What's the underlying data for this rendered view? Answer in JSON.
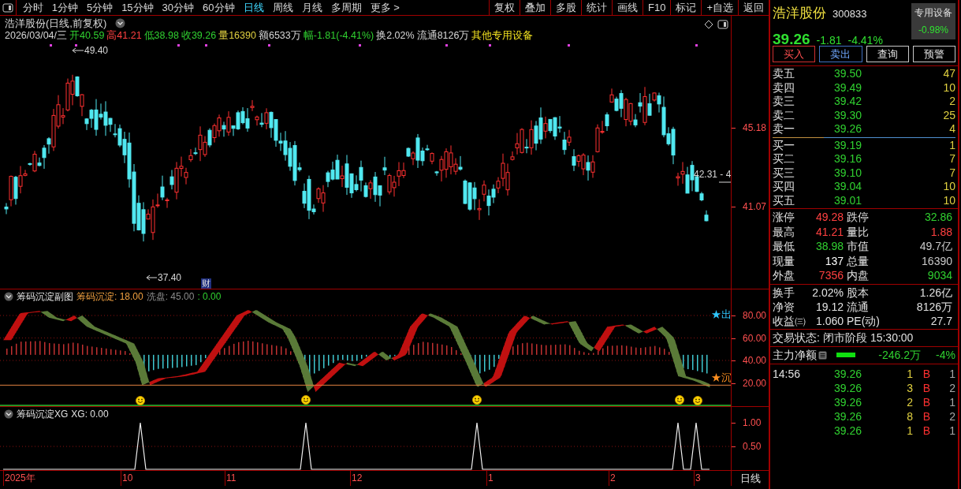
{
  "toolbar": {
    "periods": [
      {
        "label": "分时",
        "selected": false
      },
      {
        "label": "1分钟",
        "selected": false
      },
      {
        "label": "5分钟",
        "selected": false
      },
      {
        "label": "15分钟",
        "selected": false
      },
      {
        "label": "30分钟",
        "selected": false
      },
      {
        "label": "60分钟",
        "selected": false
      },
      {
        "label": "日线",
        "selected": true
      },
      {
        "label": "周线",
        "selected": false
      },
      {
        "label": "月线",
        "selected": false
      },
      {
        "label": "多周期",
        "selected": false
      },
      {
        "label": "更多 >",
        "selected": false
      }
    ],
    "actions": [
      "复权",
      "叠加",
      "多股",
      "统计",
      "画线",
      "F10",
      "标记",
      "+自选",
      "返回"
    ]
  },
  "chart": {
    "title": "浩洋股份(日线,前复权)",
    "quote": [
      {
        "text": "2026/03/04/三",
        "color": "#d8d8d8"
      },
      {
        "text": "开40.59",
        "color": "#30d030"
      },
      {
        "text": "高41.21",
        "color": "#ff4040"
      },
      {
        "text": "低38.98",
        "color": "#30d030"
      },
      {
        "text": "收39.26",
        "color": "#30d030"
      },
      {
        "text": "量16390",
        "color": "#e0d040"
      },
      {
        "text": "额6533万",
        "color": "#d8d8d8"
      },
      {
        "text": "幅-1.81(-4.41%)",
        "color": "#30d030"
      },
      {
        "text": "换2.02%",
        "color": "#d8d8d8"
      },
      {
        "text": "流通8126万",
        "color": "#d8d8d8"
      },
      {
        "text": "其他专用设备",
        "color": "#f0e020"
      }
    ],
    "price_ticks": [
      "45.18",
      "41.07"
    ],
    "high_label": "49.40",
    "low_label": "37.40",
    "event_mark": "财",
    "last_label": "42.31 - 4"
  },
  "indicator_1": {
    "name": "筹码沉淀副图",
    "values": [
      {
        "text": "筹码沉淀: 18.00",
        "color": "#f0a040"
      },
      {
        "text": "洗盘: 45.00",
        "color": "#8a8a8a"
      },
      {
        "text": ": 0.00",
        "color": "#30d030"
      }
    ],
    "ticks": [
      "80.00",
      "60.00",
      "40.00",
      "20.00"
    ],
    "markers": [
      {
        "text": "★出",
        "color": "#30c8ff"
      },
      {
        "text": "★沉",
        "color": "#ff9020"
      }
    ]
  },
  "indicator_2": {
    "name": "筹码沉淀XG",
    "value": "XG: 0.00",
    "ticks": [
      "1.00",
      "0.50"
    ]
  },
  "date_axis": {
    "labels": [
      "2025年",
      "10",
      "11",
      "12",
      "1",
      "2",
      "3"
    ],
    "period": "日线"
  },
  "stock": {
    "name": "浩洋股份",
    "code": "300833",
    "price": "39.26",
    "change": "-1.81",
    "percent": "-4.41%",
    "sector": "专用设备",
    "sector_change": "-0.98%"
  },
  "buttons": [
    {
      "label": "买入",
      "kind": "buy"
    },
    {
      "label": "卖出",
      "kind": "sell"
    },
    {
      "label": "查询",
      "kind": "plain"
    },
    {
      "label": "预警",
      "kind": "plain"
    }
  ],
  "asks": [
    {
      "label": "卖五",
      "price": "39.50",
      "volume": "47"
    },
    {
      "label": "卖四",
      "price": "39.49",
      "volume": "10"
    },
    {
      "label": "卖三",
      "price": "39.42",
      "volume": "2"
    },
    {
      "label": "卖二",
      "price": "39.30",
      "volume": "25"
    },
    {
      "label": "卖一",
      "price": "39.26",
      "volume": "4"
    }
  ],
  "bids": [
    {
      "label": "买一",
      "price": "39.19",
      "volume": "1"
    },
    {
      "label": "买二",
      "price": "39.16",
      "volume": "7"
    },
    {
      "label": "买三",
      "price": "39.10",
      "volume": "7"
    },
    {
      "label": "买四",
      "price": "39.04",
      "volume": "10"
    },
    {
      "label": "买五",
      "price": "39.01",
      "volume": "10"
    }
  ],
  "stats": [
    {
      "label": "涨停",
      "value": "49.28",
      "color": "#ff4040"
    },
    {
      "label": "跌停",
      "value": "32.86",
      "color": "#30d030"
    },
    {
      "label": "最高",
      "value": "41.21",
      "color": "#ff4040"
    },
    {
      "label": "量比",
      "value": "1.88",
      "color": "#ff4040"
    },
    {
      "label": "最低",
      "value": "38.98",
      "color": "#30d030"
    },
    {
      "label": "市值",
      "value": "49.7亿",
      "color": "#c8c8c8"
    },
    {
      "label": "现量",
      "value": "137",
      "color": "#ffffff"
    },
    {
      "label": "总量",
      "value": "16390",
      "color": "#c8c8c8"
    },
    {
      "label": "外盘",
      "value": "7356",
      "color": "#ff4040"
    },
    {
      "label": "内盘",
      "value": "9034",
      "color": "#30d030"
    }
  ],
  "fundamentals": [
    {
      "label": "换手",
      "value": "2.02%"
    },
    {
      "label": "股本",
      "value": "1.26亿"
    },
    {
      "label": "净资",
      "value": "19.12"
    },
    {
      "label": "流通",
      "value": "8126万"
    },
    {
      "label": "收益㈢",
      "value": "1.060"
    },
    {
      "label": "PE(动)",
      "value": "27.7"
    }
  ],
  "trade_status": {
    "label": "交易状态:",
    "state": "闭市阶段",
    "time": "15:30:00"
  },
  "main_flow": {
    "label": "主力净额",
    "amount": "-246.2万",
    "percent": "-4%"
  },
  "ticks": [
    {
      "time": "14:56",
      "price": "39.26",
      "volume": "1",
      "side": "B",
      "count": "1"
    },
    {
      "price": "39.26",
      "volume": "3",
      "side": "B",
      "count": "2"
    },
    {
      "price": "39.26",
      "volume": "2",
      "side": "B",
      "count": "1"
    },
    {
      "price": "39.26",
      "volume": "8",
      "side": "B",
      "count": "2"
    },
    {
      "price": "39.26",
      "volume": "1",
      "side": "B",
      "count": "1"
    }
  ]
}
